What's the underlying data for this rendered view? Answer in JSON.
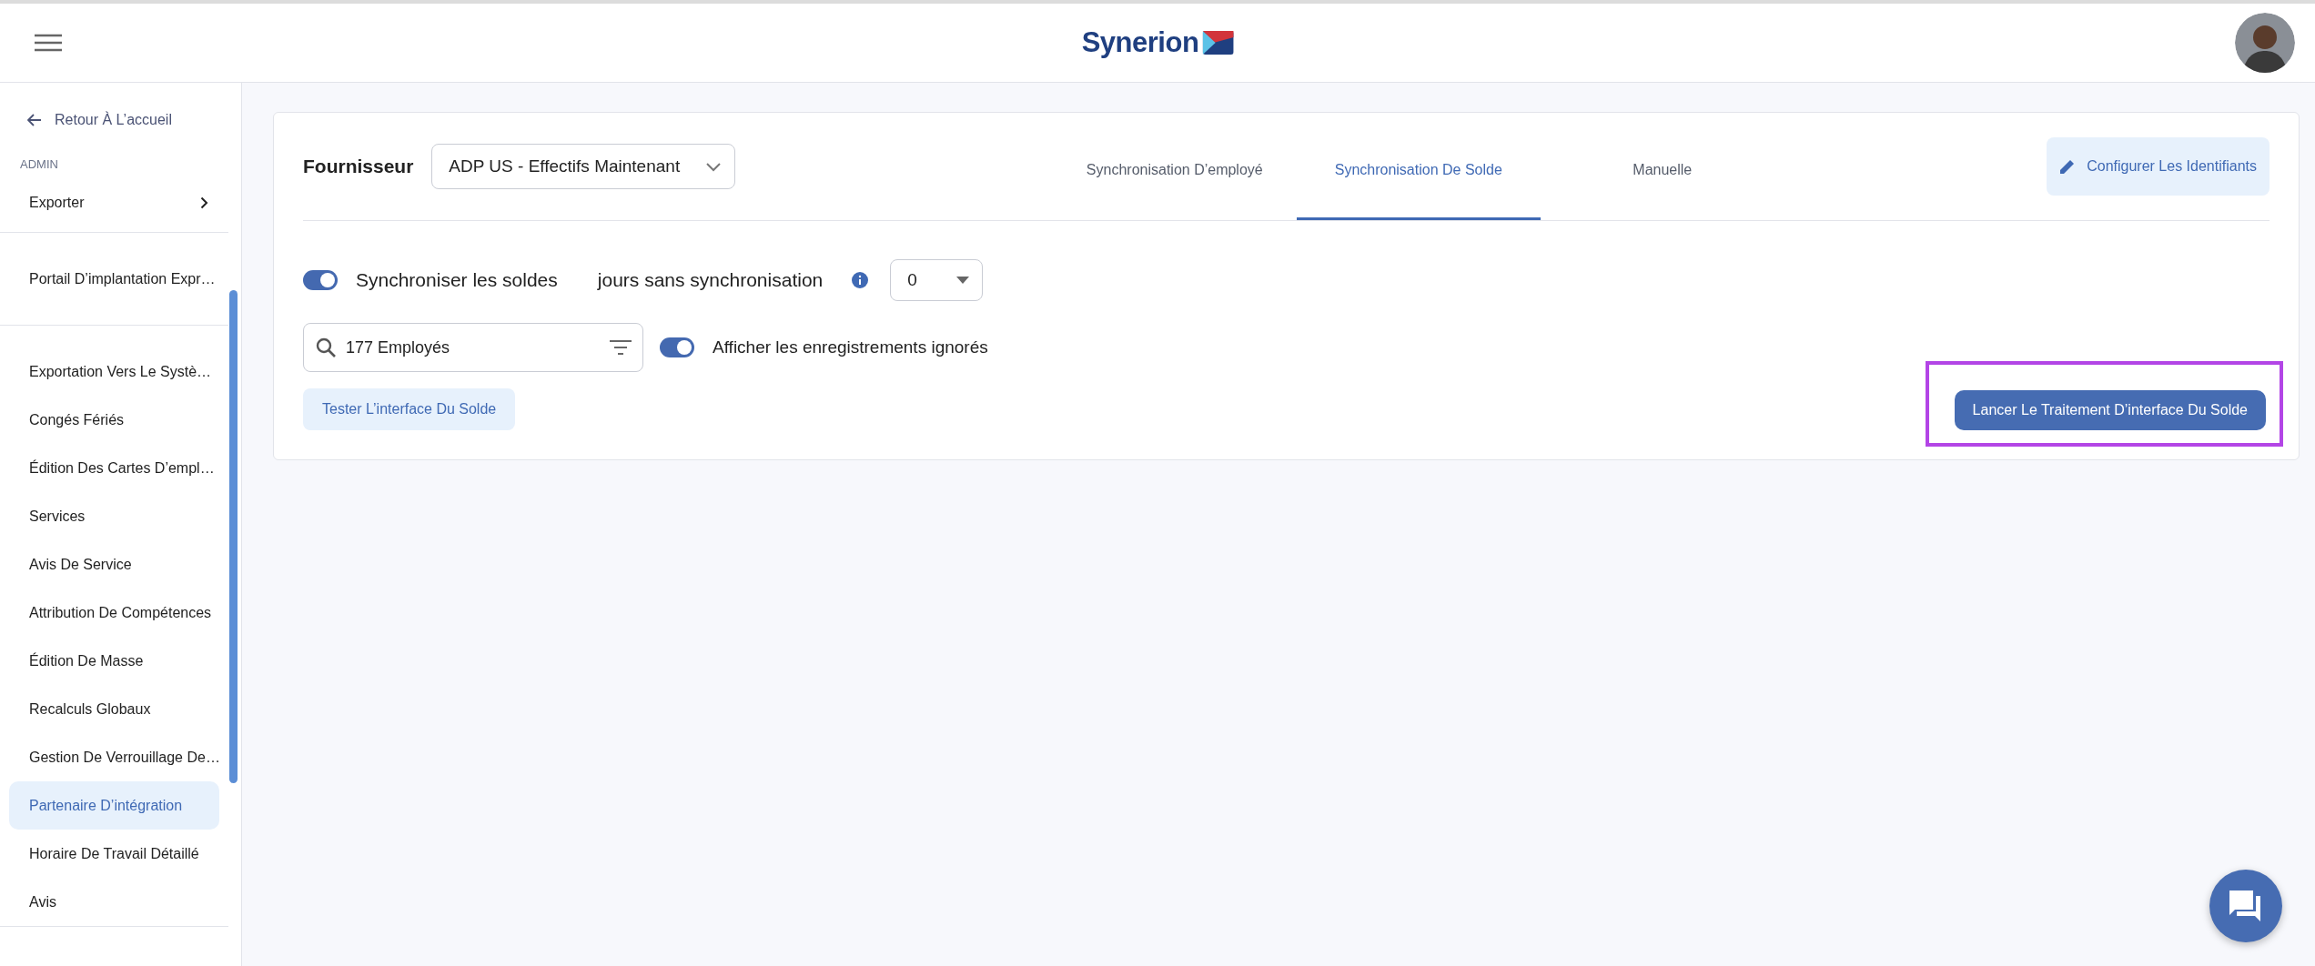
{
  "header": {
    "logo": "Synerion"
  },
  "sidebar": {
    "back_link": "Retour À L’accueil",
    "section": "ADMIN",
    "groups": [
      {
        "items": [
          {
            "label": "Exporter",
            "kind": "submenu",
            "selected": false
          }
        ]
      },
      {
        "items": [
          {
            "label": "Portail D’implantation Expr…",
            "kind": "link",
            "selected": false
          }
        ]
      },
      {
        "items": [
          {
            "label": "Exportation Vers Le Systè…",
            "kind": "link",
            "selected": false
          },
          {
            "label": "Congés Fériés",
            "kind": "link",
            "selected": false
          },
          {
            "label": "Édition Des Cartes D’empl…",
            "kind": "link",
            "selected": false
          },
          {
            "label": "Services",
            "kind": "link",
            "selected": false
          },
          {
            "label": "Avis De Service",
            "kind": "link",
            "selected": false
          },
          {
            "label": "Attribution De Compétences",
            "kind": "link",
            "selected": false
          },
          {
            "label": "Édition De Masse",
            "kind": "link",
            "selected": false
          },
          {
            "label": "Recalculs Globaux",
            "kind": "link",
            "selected": false
          },
          {
            "label": "Gestion De Verrouillage De…",
            "kind": "link",
            "selected": false
          },
          {
            "label": "Partenaire D’intégration",
            "kind": "link",
            "selected": true
          },
          {
            "label": "Horaire De Travail Détaillé",
            "kind": "link",
            "selected": false
          },
          {
            "label": "Avis",
            "kind": "link",
            "selected": false
          }
        ]
      }
    ]
  },
  "main": {
    "provider_label": "Fournisseur",
    "provider_value": "ADP US - Effectifs Maintenant",
    "tabs": [
      {
        "label": "Synchronisation D’employé",
        "selected": false
      },
      {
        "label": "Synchronisation De Solde",
        "selected": true
      },
      {
        "label": "Manuelle",
        "selected": false
      }
    ],
    "configure_button": "Configurer Les Identifiants",
    "sync_toggle": {
      "label": "Synchroniser les soldes",
      "on": true
    },
    "days_label": "jours sans synchronisation",
    "days_value": "0",
    "search_value": "177 Employés",
    "ignored_toggle": {
      "label": "Afficher les enregistrements ignorés",
      "on": true
    },
    "test_button": "Tester L’interface Du Solde",
    "launch_button": {
      "label": "Lancer Le Traitement D’interface Du Solde",
      "highlighted": true
    }
  }
}
